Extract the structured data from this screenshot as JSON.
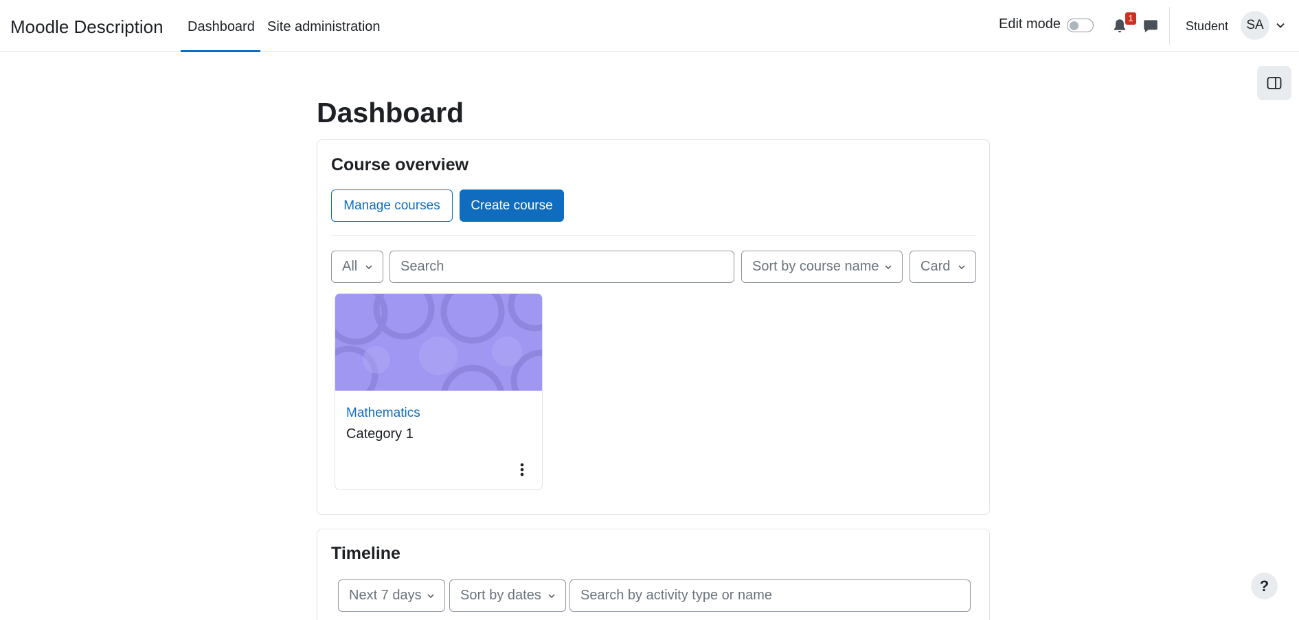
{
  "navbar": {
    "brand": "Moodle Description",
    "tabs": [
      {
        "label": "Dashboard",
        "active": true
      },
      {
        "label": "Site administration",
        "active": false
      }
    ],
    "edit_mode_label": "Edit mode",
    "edit_mode_on": false,
    "notification_count": "1",
    "user_role": "Student",
    "user_initials": "SA"
  },
  "page": {
    "title": "Dashboard"
  },
  "course_overview": {
    "title": "Course overview",
    "manage_label": "Manage courses",
    "create_label": "Create course",
    "filter_grouping": "All",
    "search_placeholder": "Search",
    "sort": "Sort by course name",
    "view": "Card",
    "courses": [
      {
        "name": "Mathematics",
        "category": "Category 1"
      }
    ]
  },
  "timeline": {
    "title": "Timeline",
    "range": "Next 7 days",
    "sort": "Sort by dates",
    "search_placeholder": "Search by activity type or name"
  },
  "help_label": "?",
  "colors": {
    "primary": "#0f6cbf",
    "badge": "#ca3120",
    "course_image": "#9f97f2"
  }
}
